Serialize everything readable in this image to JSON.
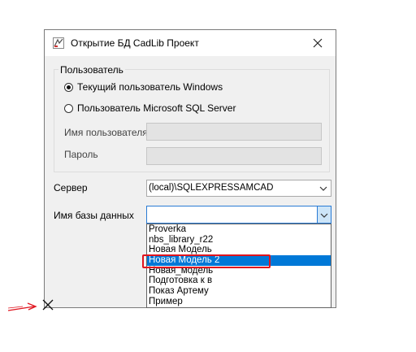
{
  "dialog": {
    "title": "Открытие БД CadLib Проект",
    "group_label": "Пользователь",
    "radio_windows": "Текущий пользователь Windows",
    "radio_sql": "Пользователь Microsoft SQL Server",
    "username_label": "Имя пользователя",
    "password_label": "Пароль",
    "username_value": "",
    "password_value": "",
    "server_label": "Сервер",
    "server_value": "(local)\\SQLEXPRESSAMCAD",
    "db_label": "Имя базы данных",
    "db_value": ""
  },
  "dropdown": {
    "items": [
      "Proverka",
      "nbs_library_r22",
      "Новая Модель",
      "Новая Модель 2",
      "Новая_модель",
      "Подготовка к в",
      "Показ Артему",
      "Пример"
    ],
    "selected_index": 3
  },
  "colors": {
    "selection": "#0078d7",
    "annotation": "#e0141e"
  }
}
